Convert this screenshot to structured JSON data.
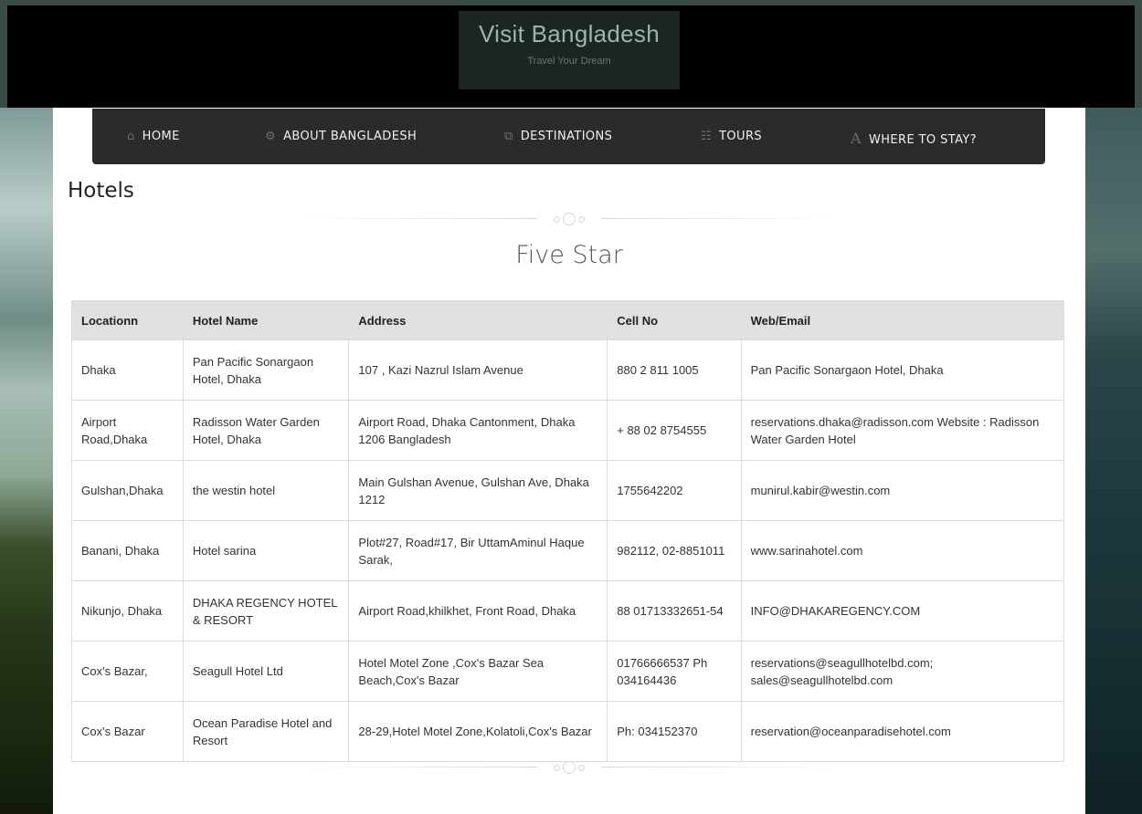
{
  "site": {
    "title": "Visit Bangladesh",
    "tagline": "Travel Your Dream"
  },
  "nav": [
    {
      "label": "HOME",
      "icon": "home-icon"
    },
    {
      "label": "ABOUT BANGLADESH",
      "icon": "gears-icon"
    },
    {
      "label": "DESTINATIONS",
      "icon": "gallery-icon"
    },
    {
      "label": "TOURS",
      "icon": "grid-list-icon"
    },
    {
      "label": "WHERE TO STAY?",
      "icon": "font-a-icon"
    }
  ],
  "page": {
    "title": "Hotels",
    "section": "Five Star"
  },
  "table": {
    "headers": [
      "Locationn",
      "Hotel Name",
      "Address",
      "Cell No",
      "Web/Email"
    ],
    "rows": [
      [
        "Dhaka",
        "Pan Pacific Sonargaon Hotel, Dhaka",
        "107 , Kazi Nazrul Islam Avenue",
        "880 2 811 1005",
        "Pan Pacific Sonargaon Hotel, Dhaka"
      ],
      [
        "Airport Road,Dhaka",
        "Radisson Water Garden Hotel, Dhaka",
        "Airport Road, Dhaka Cantonment, Dhaka 1206 Bangladesh",
        "+ 88 02 8754555",
        "reservations.dhaka@radisson.com Website : Radisson Water Garden Hotel"
      ],
      [
        "Gulshan,Dhaka",
        "the westin hotel",
        "Main Gulshan Avenue, Gulshan Ave, Dhaka 1212",
        "1755642202",
        "munirul.kabir@westin.com"
      ],
      [
        "Banani, Dhaka",
        "Hotel sarina",
        "Plot#27, Road#17, Bir UttamAminul Haque Sarak,",
        "982112, 02-8851011",
        "www.sarinahotel.com"
      ],
      [
        "Nikunjo, Dhaka",
        "DHAKA REGENCY HOTEL & RESORT",
        "Airport Road,khilkhet, Front Road, Dhaka",
        "88 01713332651-54",
        "INFO@DHAKAREGENCY.COM"
      ],
      [
        "Cox's Bazar,",
        "Seagull Hotel Ltd",
        "Hotel Motel Zone ,Cox's Bazar Sea Beach,Cox's Bazar",
        "01766666537 Ph 034164436",
        "reservations@seagullhotelbd.com; sales@seagullhotelbd.com"
      ],
      [
        "Cox's Bazar",
        "Ocean Paradise Hotel and Resort",
        "28-29,Hotel Motel Zone,Kolatoli,Cox's Bazar",
        "Ph: 034152370",
        "reservation@oceanparadisehotel.com"
      ]
    ]
  }
}
